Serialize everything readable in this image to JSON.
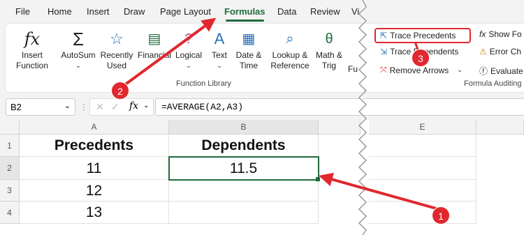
{
  "tabs": [
    "File",
    "Home",
    "Insert",
    "Draw",
    "Page Layout",
    "Formulas",
    "Data",
    "Review",
    "Vi"
  ],
  "active_tab": "Formulas",
  "ribbon": {
    "insert_function": [
      "Insert",
      "Function"
    ],
    "autosum": "AutoSum",
    "recently_used": [
      "Recently",
      "Used"
    ],
    "financial": "Financial",
    "logical": "Logical",
    "text": "Text",
    "date_time": [
      "Date &",
      "Time"
    ],
    "lookup": [
      "Lookup &",
      "Reference"
    ],
    "math": [
      "Math &",
      "Trig"
    ],
    "more": "Fu",
    "function_library_label": "Function Library",
    "trace_precedents": "Trace Precedents",
    "trace_dependents": "Trace Dependents",
    "remove_arrows": "Remove Arrows",
    "show_formulas": "Show Fo",
    "error_checking": "Error Ch",
    "evaluate": "Evaluate",
    "formula_auditing_label": "Formula Auditing"
  },
  "formula_bar": {
    "name_box": "B2",
    "fx": "fx",
    "formula": "=AVERAGE(A2,A3)"
  },
  "columns": [
    "A",
    "B",
    "E"
  ],
  "rows": [
    "1",
    "2",
    "3",
    "4"
  ],
  "cells": {
    "A1": "Precedents",
    "B1": "Dependents",
    "A2": "11",
    "B2": "11.5",
    "A3": "12",
    "A4": "13"
  },
  "callouts": [
    "1",
    "2",
    "3"
  ],
  "colors": {
    "accent": "#1e6b3c",
    "annotation": "#e0282e"
  }
}
